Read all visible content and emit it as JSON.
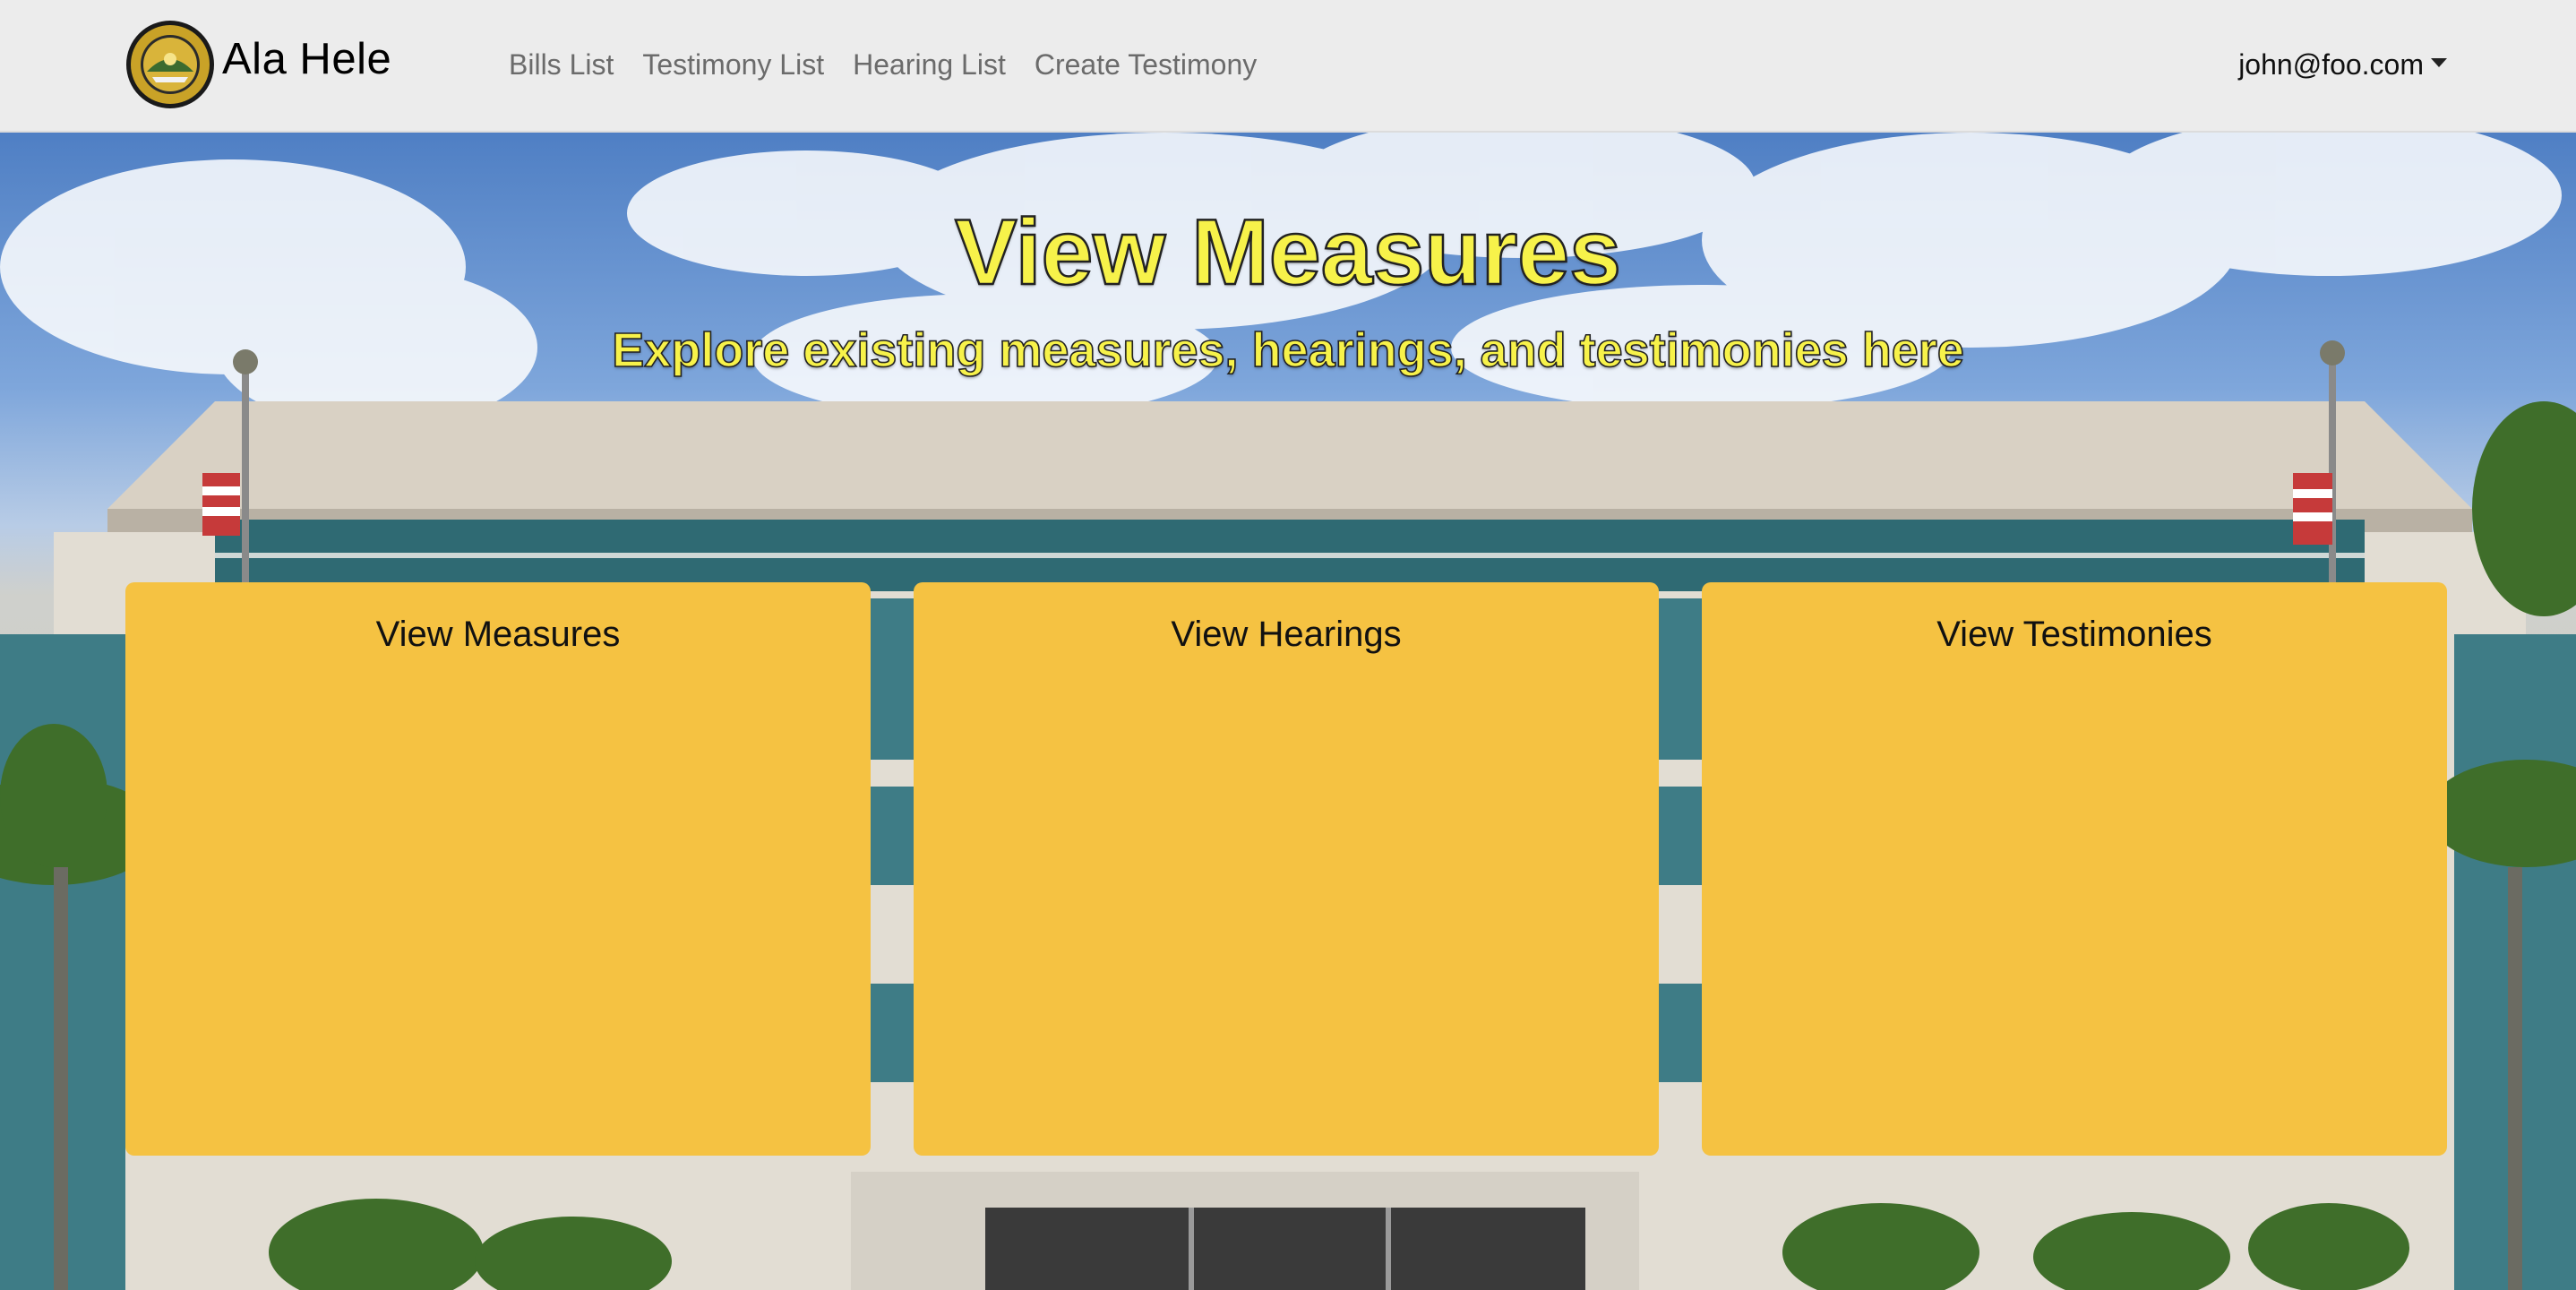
{
  "navbar": {
    "brand_name": "Ala Hele",
    "logo_icon": "department-seal-icon",
    "links": [
      {
        "label": "Bills List"
      },
      {
        "label": "Testimony List"
      },
      {
        "label": "Hearing List"
      },
      {
        "label": "Create Testimony"
      }
    ],
    "user_email": "john@foo.com"
  },
  "hero": {
    "title": "View Measures",
    "subtitle": "Explore existing measures, hearings, and testimonies here",
    "text_color": "#f7f24a",
    "cards": [
      {
        "title": "View Measures"
      },
      {
        "title": "View Hearings"
      },
      {
        "title": "View Testimonies"
      }
    ],
    "card_color": "#f5c242"
  }
}
